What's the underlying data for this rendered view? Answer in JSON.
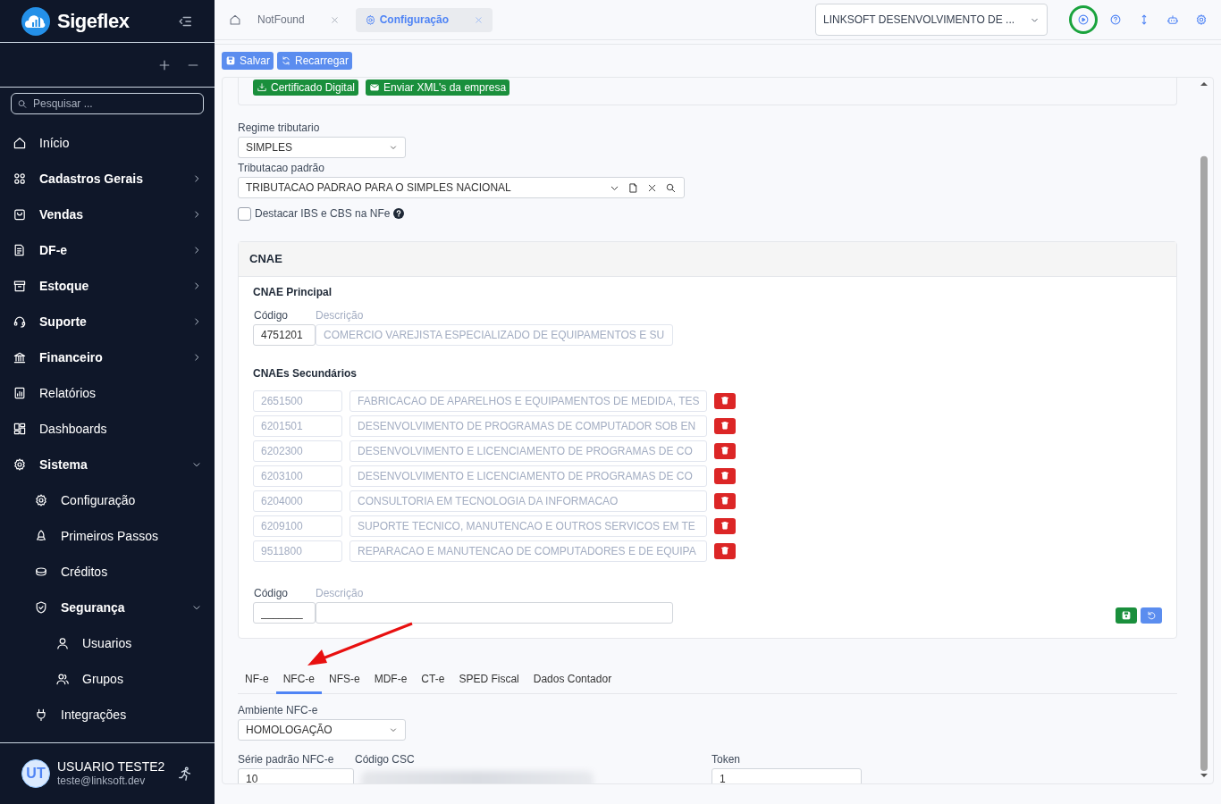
{
  "brand": {
    "name": "Sigeflex"
  },
  "sidebar": {
    "search": {
      "placeholder": "Pesquisar ..."
    },
    "items": [
      {
        "label": "Início"
      },
      {
        "label": "Cadastros Gerais",
        "expanded": false
      },
      {
        "label": "Vendas",
        "expanded": false
      },
      {
        "label": "DF-e",
        "expanded": false
      },
      {
        "label": "Estoque",
        "expanded": false
      },
      {
        "label": "Suporte",
        "expanded": false
      },
      {
        "label": "Financeiro",
        "expanded": false
      },
      {
        "label": "Relatórios"
      },
      {
        "label": "Dashboards"
      },
      {
        "label": "Sistema",
        "expanded": true,
        "children": [
          {
            "label": "Configuração"
          },
          {
            "label": "Primeiros Passos"
          },
          {
            "label": "Créditos"
          },
          {
            "label": "Segurança",
            "expanded": true,
            "children": [
              {
                "label": "Usuarios"
              },
              {
                "label": "Grupos"
              }
            ]
          },
          {
            "label": "Integrações"
          }
        ]
      }
    ]
  },
  "user": {
    "initials": "UT",
    "name": "USUARIO TESTE2",
    "email": "teste@linksoft.dev"
  },
  "tabs": [
    {
      "label": "NotFound",
      "selected": false
    },
    {
      "label": "Configuração",
      "selected": true
    }
  ],
  "company_select": {
    "value": "LINKSOFT DESENVOLVIMENTO DE ..."
  },
  "toolbar": {
    "buttons": [
      "Salvar",
      "Recarregar"
    ]
  },
  "certificate_buttons": [
    "Certificado Digital",
    "Enviar XML's da empresa"
  ],
  "regime": {
    "label": "Regime tributario",
    "value": "SIMPLES"
  },
  "tributacao": {
    "label": "Tributacao padrão",
    "value": "TRIBUTACAO PADRAO PARA O SIMPLES NACIONAL"
  },
  "destacar": {
    "label": "Destacar IBS e CBS na NFe",
    "checked": false
  },
  "cnae": {
    "title": "CNAE",
    "principal": {
      "heading": "CNAE Principal",
      "code_label": "Código",
      "description_label": "Descrição",
      "code": "4751201",
      "description": "COMERCIO VAREJISTA ESPECIALIZADO DE EQUIPAMENTOS E SU"
    },
    "secondary_heading": "CNAEs Secundários",
    "secondary": [
      {
        "code": "2651500",
        "description": "FABRICACAO DE APARELHOS E EQUIPAMENTOS DE MEDIDA, TES"
      },
      {
        "code": "6201501",
        "description": "DESENVOLVIMENTO DE PROGRAMAS DE COMPUTADOR SOB EN"
      },
      {
        "code": "6202300",
        "description": "DESENVOLVIMENTO E LICENCIAMENTO DE PROGRAMAS DE CO"
      },
      {
        "code": "6203100",
        "description": "DESENVOLVIMENTO E LICENCIAMENTO DE PROGRAMAS DE CO"
      },
      {
        "code": "6204000",
        "description": "CONSULTORIA EM TECNOLOGIA DA INFORMACAO"
      },
      {
        "code": "6209100",
        "description": "SUPORTE TECNICO, MANUTENCAO E OUTROS SERVICOS EM TE"
      },
      {
        "code": "9511800",
        "description": "REPARACAO E MANUTENCAO DE COMPUTADORES E DE EQUIPA"
      }
    ],
    "new_entry": {
      "code_label": "Código",
      "description_label": "Descrição",
      "code": "_______"
    }
  },
  "fiscal_tabs": [
    {
      "label": "NF-e",
      "selected": false
    },
    {
      "label": "NFC-e",
      "selected": true
    },
    {
      "label": "NFS-e",
      "selected": false
    },
    {
      "label": "MDF-e",
      "selected": false
    },
    {
      "label": "CT-e",
      "selected": false
    },
    {
      "label": "SPED Fiscal",
      "selected": false
    },
    {
      "label": "Dados Contador",
      "selected": false
    }
  ],
  "nfce": {
    "ambiente": {
      "label": "Ambiente NFC-e",
      "value": "HOMOLOGAÇÃO"
    },
    "serie": {
      "label": "Série padrão NFC-e",
      "value": "10"
    },
    "csc": {
      "label": "Código CSC"
    },
    "token": {
      "label": "Token",
      "value": "1"
    }
  }
}
